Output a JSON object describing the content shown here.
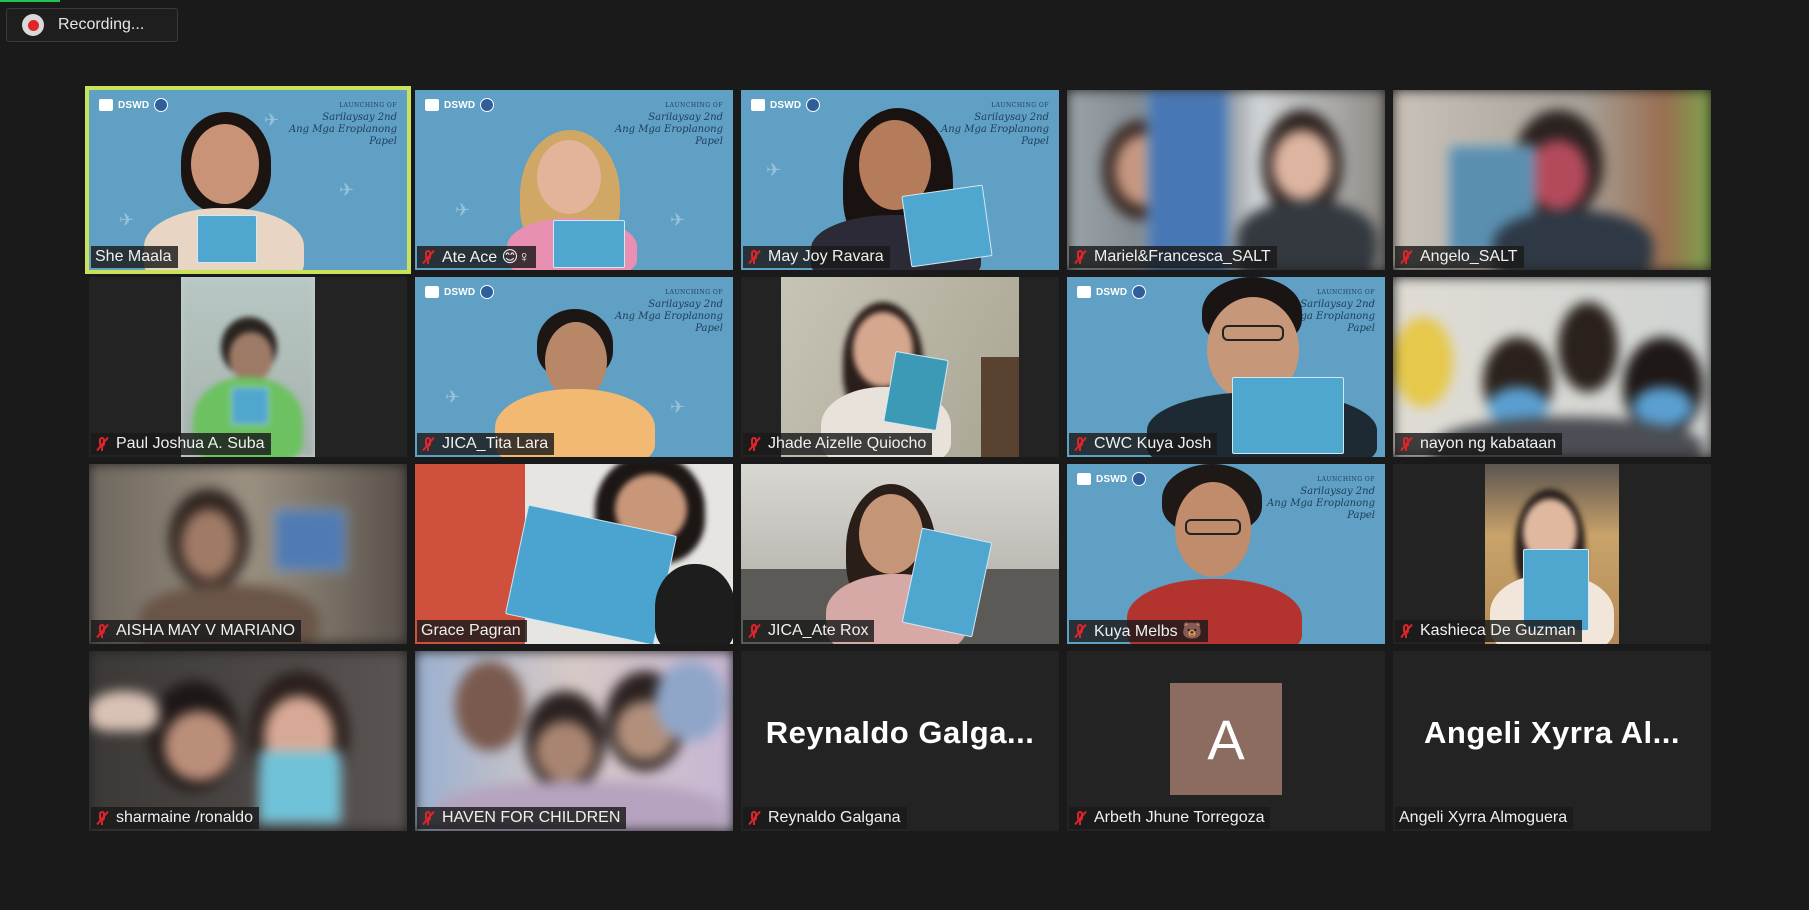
{
  "recording": {
    "label": "Recording...",
    "icon": "record-icon",
    "color": "#e0242a"
  },
  "background_banner": {
    "org": "DSWD",
    "small_title": "LAUNCHING OF",
    "title_line1": "Sarilaysay 2nd",
    "title_line2": "Ang Mga Eroplanong Papel"
  },
  "colors": {
    "active_speaker": "#c8e35b",
    "muted": "#e0242a",
    "tile_bg": "#232323",
    "dswd_bg": "#5fa0c4"
  },
  "participants": [
    {
      "name": "She Maala",
      "muted": false,
      "active": true
    },
    {
      "name": "Ate Ace 😊♀",
      "muted": true
    },
    {
      "name": "May Joy Ravara",
      "muted": true
    },
    {
      "name": "Mariel&Francesca_SALT",
      "muted": true
    },
    {
      "name": "Angelo_SALT",
      "muted": true
    },
    {
      "name": "Paul Joshua A. Suba",
      "muted": true
    },
    {
      "name": "JICA_Tita Lara",
      "muted": true
    },
    {
      "name": "Jhade Aizelle Quiocho",
      "muted": true
    },
    {
      "name": "CWC Kuya Josh",
      "muted": true
    },
    {
      "name": "nayon ng kabataan",
      "muted": true
    },
    {
      "name": "AISHA MAY V MARIANO",
      "muted": true
    },
    {
      "name": "Grace Pagran",
      "muted": false
    },
    {
      "name": "JICA_Ate Rox",
      "muted": true
    },
    {
      "name": "Kuya Melbs 🐻",
      "muted": true
    },
    {
      "name": "Kashieca De Guzman",
      "muted": true
    },
    {
      "name": "sharmaine /ronaldo",
      "muted": true
    },
    {
      "name": "HAVEN FOR CHILDREN",
      "muted": true
    },
    {
      "name": "Reynaldo Galgana",
      "muted": true,
      "video_off_label": "Reynaldo  Galga..."
    },
    {
      "name": "Arbeth Jhune Torregoza",
      "muted": true,
      "avatar_letter": "A"
    },
    {
      "name": "Angeli Xyrra Almoguera",
      "muted": false,
      "video_off_label": "Angeli  Xyrra  Al..."
    }
  ]
}
